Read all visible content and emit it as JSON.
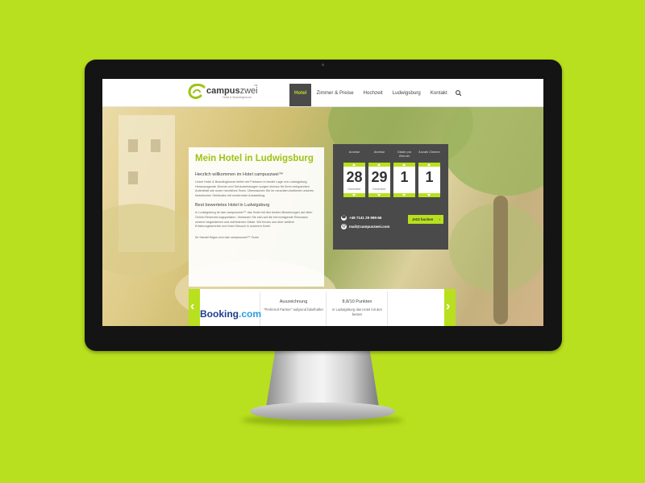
{
  "brand": {
    "name_bold": "campus",
    "name_rest": "zwei",
    "tm": "TM",
    "tagline": "Hotel & Boardinghouse"
  },
  "nav": {
    "items": [
      "Hotel",
      "Zimmer & Preise",
      "Hochzeit",
      "Ludwigsburg",
      "Kontakt"
    ],
    "active_index": 0
  },
  "content": {
    "title": "Mein Hotel in Ludwigsburg",
    "welcome_heading": "Herzlich willkommen im Hotel campuszwei™",
    "welcome_text": "Unser Hotel & Boardinghouse bietet viel Freiraum in bester Lage von Ludwigsburg. Herausragende Zimmer und Serviceleistungen sorgen ebenso für Ihren entspannten Aufenthalt wie unser herzliches Team. Überraschen Sie im neuvollen Ambiente unseres historischen Gebäudes mit modernster Ausstattung.",
    "rated_heading": "Best bewertetes Hotel in Ludwigsburg",
    "rated_text": "In Ludwigsburg ist das campuszwei™ das Hotel mit den besten Bewertungen auf allen Online-Reservierungsportalen. Verlassen Sie sich auf die hervorragende Resonanz unserer begeisterten und zufriedenen Gäste. Wir freuen uns über weitere Erfahrungsberichte und Ihren Besuch in unserem Hotel.",
    "signature": "Ihr Harald Kilgus und das campuszwei™-Team"
  },
  "booking": {
    "labels": [
      "Anreise",
      "Abreise",
      "Gäste pro Zimmer",
      "Anzahl Zimmer"
    ],
    "values": [
      "28",
      "29",
      "1",
      "1"
    ],
    "months": [
      "Dezember",
      "Dezember",
      "",
      ""
    ],
    "phone": "+49 7141 29 999-66",
    "email": "mail@campuszwei.com",
    "button": "Jetzt buchen",
    "accent": "#b8e01e"
  },
  "ratings": {
    "booking_logo_main": "Booking",
    "booking_logo_tld": ".com",
    "cells": [
      {
        "title": "Auszeichnung",
        "desc": "\"Preferred Partner\" aufgrund fabelhafter"
      },
      {
        "title": "8,8/10 Punkten",
        "desc": "in Ludwigsburg das Hotel mit den besten"
      }
    ]
  }
}
